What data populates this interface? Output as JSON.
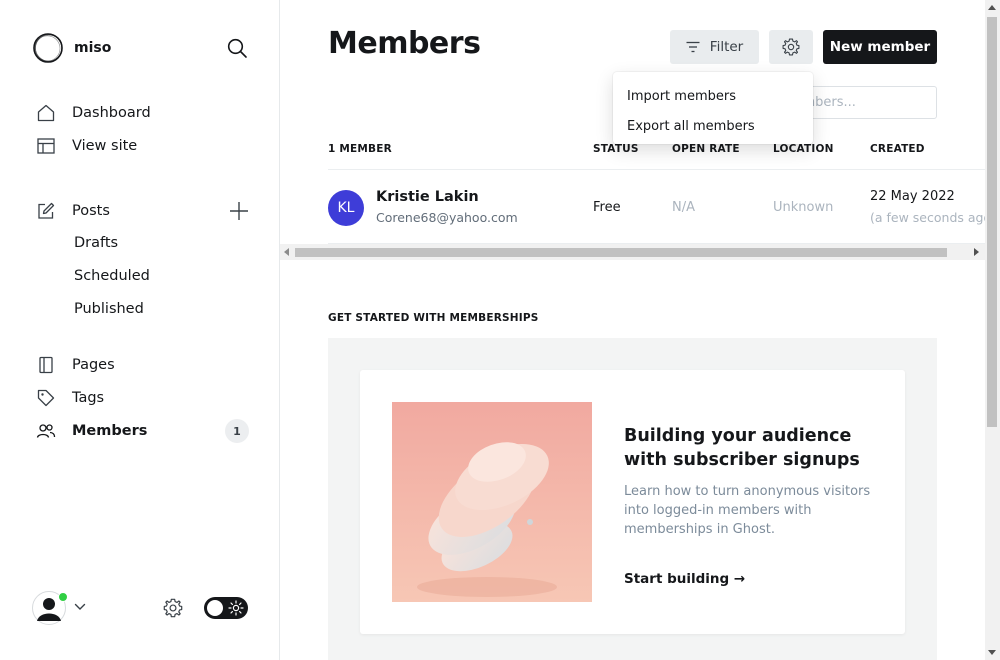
{
  "sidebar": {
    "site_name": "miso",
    "nav_main": [
      {
        "label": "Dashboard",
        "icon": "home-icon"
      },
      {
        "label": "View site",
        "icon": "layout-icon"
      }
    ],
    "posts": {
      "label": "Posts",
      "icon": "edit-icon"
    },
    "posts_sub": [
      "Drafts",
      "Scheduled",
      "Published"
    ],
    "nav_secondary": [
      {
        "label": "Pages",
        "icon": "page-icon"
      },
      {
        "label": "Tags",
        "icon": "tag-icon"
      },
      {
        "label": "Members",
        "icon": "members-icon",
        "count": "1"
      }
    ]
  },
  "header": {
    "title": "Members",
    "filter_label": "Filter",
    "new_member_label": "New member"
  },
  "search": {
    "placeholder": "Search members..."
  },
  "actions_menu": [
    "Import members",
    "Export all members"
  ],
  "table": {
    "count_label": "1 MEMBER",
    "columns": [
      "STATUS",
      "OPEN RATE",
      "LOCATION",
      "CREATED"
    ],
    "rows": [
      {
        "initials": "KL",
        "name": "Kristie Lakin",
        "email": "Corene68@yahoo.com",
        "status": "Free",
        "open_rate": "N/A",
        "location": "Unknown",
        "created": "22 May 2022",
        "created_relative": "(a few seconds ago)"
      }
    ]
  },
  "get_started": {
    "section_title": "GET STARTED WITH MEMBERSHIPS",
    "heading": "Building your audience with subscriber signups",
    "description": "Learn how to turn anonymous visitors into logged-in members with memberships in Ghost.",
    "cta": "Start building →"
  },
  "colors": {
    "accent": "#15171a",
    "avatar_bg": "#3e3dd8",
    "online": "#30cf43"
  }
}
